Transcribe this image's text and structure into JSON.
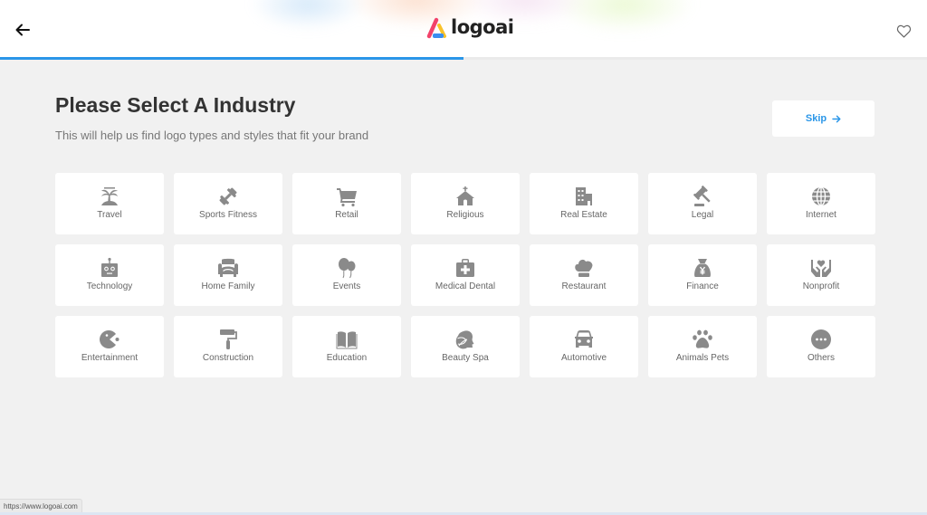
{
  "header": {
    "back_icon": "arrow-left-icon",
    "logo_text": "logoai",
    "favorite_icon": "heart-outline-icon",
    "progress_percent": 50,
    "progress_color": "#2a96e8"
  },
  "main": {
    "title": "Please Select A Industry",
    "subtitle": "This will help us find logo types and styles that fit your brand",
    "skip_label": "Skip",
    "skip_icon": "arrow-right-icon",
    "accent_color": "#2a96e8"
  },
  "industries": [
    {
      "label": "Travel",
      "icon": "palm-tree-icon"
    },
    {
      "label": "Sports Fitness",
      "icon": "dumbbell-icon"
    },
    {
      "label": "Retail",
      "icon": "shopping-cart-icon"
    },
    {
      "label": "Religious",
      "icon": "church-icon"
    },
    {
      "label": "Real Estate",
      "icon": "building-icon"
    },
    {
      "label": "Legal",
      "icon": "gavel-icon"
    },
    {
      "label": "Internet",
      "icon": "globe-icon"
    },
    {
      "label": "Technology",
      "icon": "robot-icon"
    },
    {
      "label": "Home Family",
      "icon": "armchair-icon"
    },
    {
      "label": "Events",
      "icon": "balloons-icon"
    },
    {
      "label": "Medical Dental",
      "icon": "first-aid-kit-icon"
    },
    {
      "label": "Restaurant",
      "icon": "chef-hat-icon"
    },
    {
      "label": "Finance",
      "icon": "money-bag-icon"
    },
    {
      "label": "Nonprofit",
      "icon": "hands-heart-icon"
    },
    {
      "label": "Entertainment",
      "icon": "pacman-icon"
    },
    {
      "label": "Construction",
      "icon": "paint-roller-icon"
    },
    {
      "label": "Education",
      "icon": "open-book-icon"
    },
    {
      "label": "Beauty Spa",
      "icon": "leaf-face-icon"
    },
    {
      "label": "Automotive",
      "icon": "car-icon"
    },
    {
      "label": "Animals Pets",
      "icon": "paw-icon"
    },
    {
      "label": "Others",
      "icon": "more-dots-icon"
    }
  ],
  "status_bar": {
    "url": "https://www.logoai.com"
  }
}
